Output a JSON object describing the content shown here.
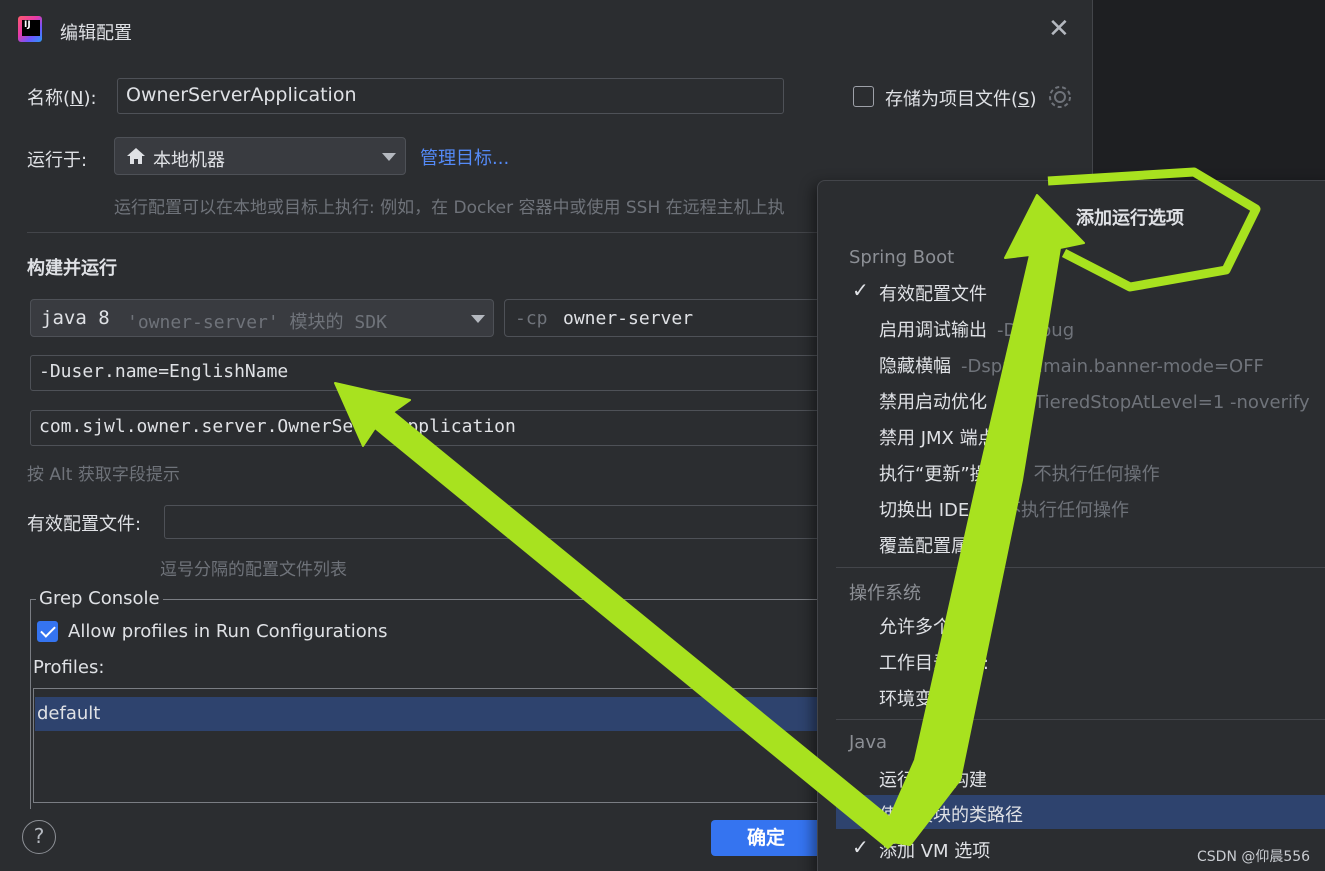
{
  "window": {
    "title": "编辑配置"
  },
  "name_row": {
    "label_prefix": "名称(",
    "mnemonic": "N",
    "label_suffix": "):",
    "value": "OwnerServerApplication"
  },
  "store_as_project": {
    "label_prefix": "存储为项目文件(",
    "mnemonic": "S",
    "label_suffix": ")",
    "checked": false
  },
  "run_on": {
    "label": "运行于:",
    "selected": "本地机器",
    "manage_link": "管理目标...",
    "hint": "运行配置可以在本地或目标上执行: 例如，在 Docker 容器中或使用 SSH 在远程主机上执"
  },
  "build_run": {
    "heading": "构建并运行",
    "sdk": {
      "main": "java 8",
      "detail": "'owner-server' 模块的 SDK"
    },
    "classpath": {
      "flag": "-cp",
      "value": "owner-server"
    },
    "vm_options": "-Duser.name=EnglishName",
    "main_class": "com.sjwl.owner.server.OwnerServerApplication",
    "alt_hint": "按 Alt 获取字段提示"
  },
  "profiles_row": {
    "label": "有效配置文件:",
    "value": "",
    "hint": "逗号分隔的配置文件列表"
  },
  "grep_console": {
    "legend": "Grep Console",
    "allow_label": "Allow profiles in Run Configurations",
    "allow_checked": true,
    "profiles_label": "Profiles:",
    "profiles": [
      "default"
    ]
  },
  "buttons": {
    "ok": "确定",
    "help": "?"
  },
  "popup": {
    "title": "添加运行选项",
    "sections": [
      {
        "name": "Spring Boot",
        "items": [
          {
            "label": "有效配置文件",
            "sub": "",
            "checked": true
          },
          {
            "label": "启用调试输出",
            "sub": "-Ddebug",
            "checked": false
          },
          {
            "label": "隐藏横幅",
            "sub": "-Dspring.main.banner-mode=OFF",
            "checked": false
          },
          {
            "label": "禁用启动优化",
            "sub": "-XX:TieredStopAtLevel=1 -noverify",
            "checked": false
          },
          {
            "label": "禁用 JMX 端点",
            "sub": "",
            "checked": false
          },
          {
            "label": "执行“更新”操作时",
            "sub": "不执行任何操作",
            "checked": false
          },
          {
            "label": "切换出 IDE 时",
            "sub": "不执行任何操作",
            "checked": false
          },
          {
            "label": "覆盖配置属性",
            "sub": "",
            "checked": false
          }
        ]
      },
      {
        "name": "操作系统",
        "items": [
          {
            "label": "允许多个实例",
            "sub": "",
            "checked": false
          },
          {
            "label": "工作目录(W):",
            "sub": "",
            "checked": false
          },
          {
            "label": "环境变量",
            "sub": "",
            "checked": false
          }
        ]
      },
      {
        "name": "Java",
        "items": [
          {
            "label": "运行前不构建",
            "sub": "",
            "checked": false
          },
          {
            "label": "使用模块的类路径",
            "sub": "",
            "checked": false,
            "selected": true
          },
          {
            "label": "添加 VM 选项",
            "sub": "",
            "checked": true
          }
        ]
      }
    ]
  },
  "watermark": "CSDN @仰晨556",
  "colors": {
    "accent": "#3574f0",
    "annotation": "#a8e21f",
    "selection": "#2e436e"
  }
}
